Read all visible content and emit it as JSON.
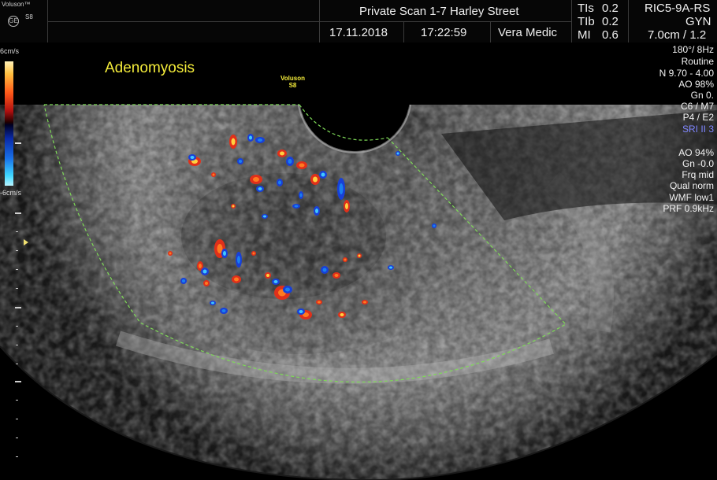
{
  "device": {
    "brand": "Voluson™",
    "model": "S8"
  },
  "header": {
    "institution": "Private Scan 1-7 Harley Street",
    "date": "17.11.2018",
    "time": "17:22:59",
    "operator": "Vera Medic",
    "tis_label": "TIs",
    "tis_value": "0.2",
    "tib_label": "TIb",
    "tib_value": "0.2",
    "mi_label": "MI",
    "mi_value": "0.6",
    "probe": "RIC5-9A-RS",
    "application": "GYN",
    "depth_line": "7.0cm / 1.2"
  },
  "annotation": "Adenomyosis",
  "mini_logo": {
    "line1": "Voluson",
    "line2": "S8"
  },
  "colorbar": {
    "top_label": "6cm/s",
    "bottom_label": "-6cm/s"
  },
  "params_2d": [
    "180°/  8Hz",
    "Routine",
    "N 9.70 - 4.00",
    "AO 98%",
    "Gn  0.",
    "C6 / M7",
    "P4 / E2",
    "SRI II 3"
  ],
  "params_color": [
    "AO 94%",
    "Gn -0.0",
    "Frq mid",
    "Qual norm",
    "WMF low1",
    "PRF  0.9kHz"
  ],
  "colors": {
    "annotation": "#f4ec3a",
    "roi_box": "#7ed957",
    "sri_label": "#7f86ff"
  }
}
